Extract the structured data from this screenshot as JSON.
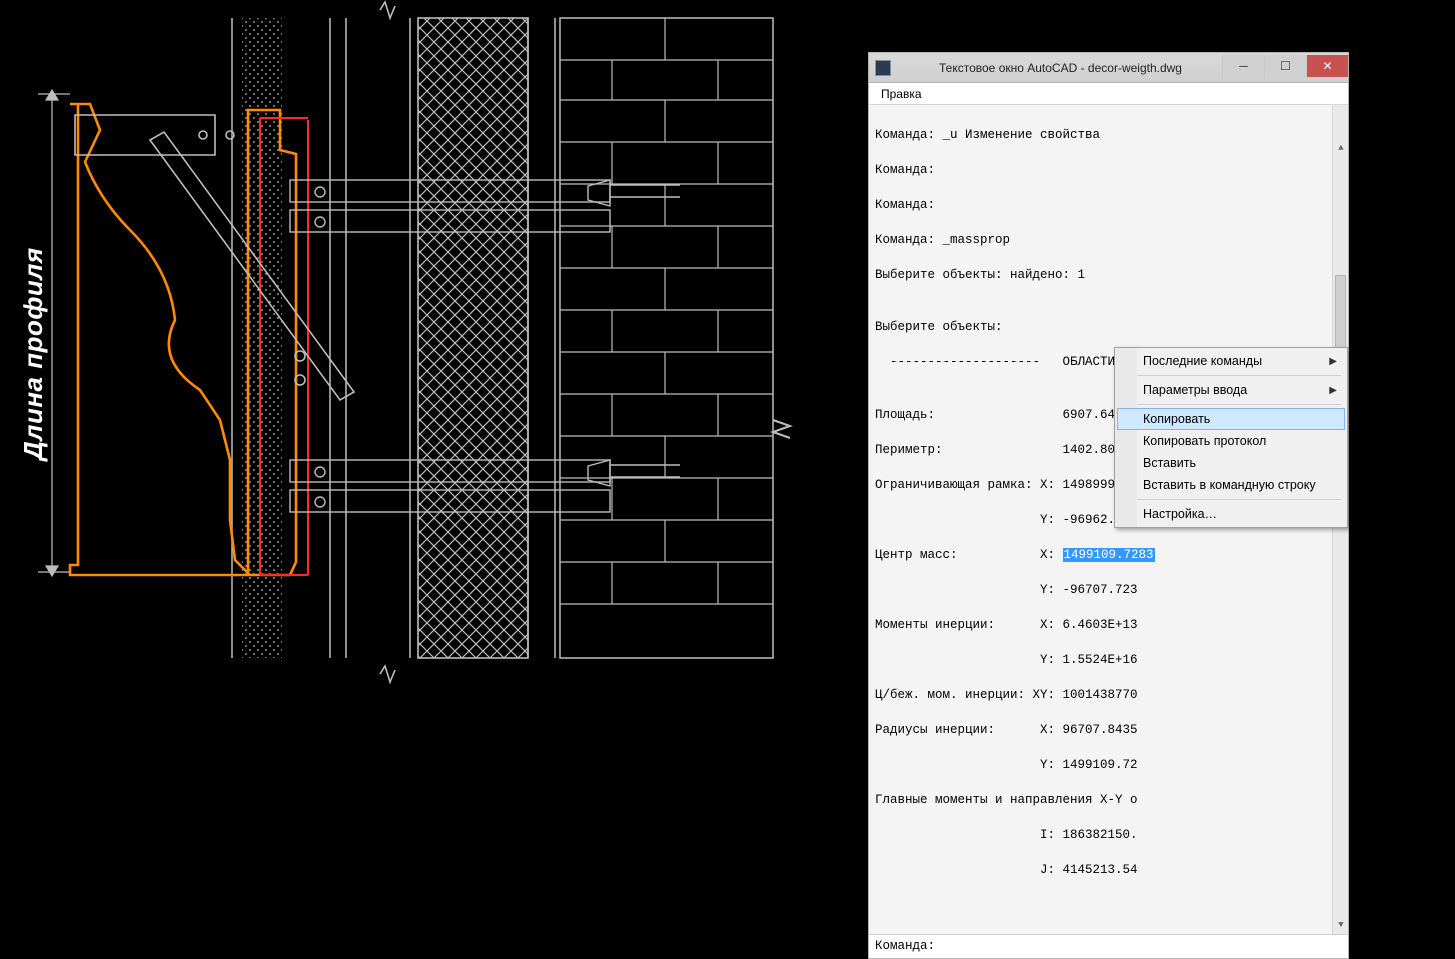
{
  "drawing": {
    "profile_label": "Длина профиля"
  },
  "window": {
    "title": "Текстовое окно AutoCAD - decor-weigth.dwg",
    "menu": {
      "edit": "Правка"
    },
    "output": {
      "l1": "Команда: _u Изменение свойства",
      "l2": "Команда:",
      "l3": "Команда:",
      "l4": "Команда: _massprop",
      "l5": "Выберите объекты: найдено: 1",
      "l6": "",
      "l7": "Выберите объекты:",
      "l8": "  --------------------   ОБЛАСТИ   --------------------",
      "l9": "",
      "l10": "Площадь:                 6907.6416",
      "l11": "Периметр:                1402.8080",
      "l12": "Ограничивающая рамка: X: 1498999.9999  --  1499199.9999",
      "l13": "                      Y: -96962.8284  --  -96465.4167",
      "l14a": "Центр масс:           X: ",
      "l14sel": "1499109.7283",
      "l15": "                      Y: -96707.723",
      "l16": "Моменты инерции:      X: 6.4603E+13",
      "l17": "                      Y: 1.5524E+16",
      "l18": "Ц/беж. мом. инерции: XY: 1001438770",
      "l19": "Радиусы инерции:      X: 96707.8435",
      "l20": "                      Y: 1499109.72",
      "l21": "Главные моменты и направления X-Y о",
      "l22": "                      I: 186382150.",
      "l23": "                      J: 4145213.54"
    },
    "cmd_prompt": "Команда:"
  },
  "context_menu": {
    "recent": "Последние команды",
    "params": "Параметры ввода",
    "copy": "Копировать",
    "copylog": "Копировать протокол",
    "paste": "Вставить",
    "pastecmd": "Вставить в командную строку",
    "settings": "Настройка…"
  }
}
